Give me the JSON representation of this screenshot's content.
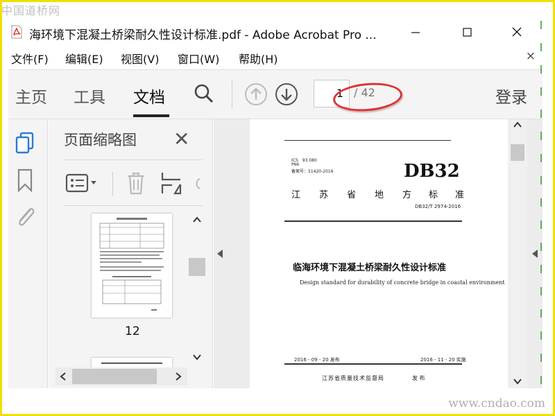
{
  "watermark": {
    "top": "中国道桥网",
    "bottom": "www.cndao.com"
  },
  "window": {
    "title": "海环境下混凝土桥梁耐久性设计标准.pdf - Adobe Acrobat Pro ..."
  },
  "menu": [
    "文件(F)",
    "编辑(E)",
    "视图(V)",
    "窗口(W)",
    "帮助(H)"
  ],
  "menu_close_glyph": "×",
  "toolbar": {
    "tabs": [
      "主页",
      "工具",
      "文档"
    ],
    "active_tab": "文档",
    "page_current": "1",
    "page_total": "/ 42",
    "login": "登录"
  },
  "thumb_panel": {
    "title": "页面缩略图",
    "close_glyph": "✕",
    "thumbnail_label": "12"
  },
  "document": {
    "ics": "ICS　93.080",
    "p_code": "P66",
    "record_no": "备案号：51420-2016",
    "db_label": "DB32",
    "province_chars": [
      "江",
      "苏",
      "省",
      "地",
      "方",
      "标",
      "准"
    ],
    "std_no": "DB32/T 2974-2016",
    "title_cn": "临海环境下混凝土桥梁耐久性设计标准",
    "title_en": "Design standard for durability of concrete bridge in coastal environment",
    "issue_date": "2016 - 09 - 20 发布",
    "impl_date": "2016 - 11 - 20 实施",
    "issuer": "江苏省质量技术监督局",
    "fa": "发 布"
  },
  "colors": {
    "frame": "#f0e000",
    "highlight": "#dd3333",
    "acrobat_red": "#e0201a",
    "rail_icon_blue": "#2a7ad6"
  }
}
